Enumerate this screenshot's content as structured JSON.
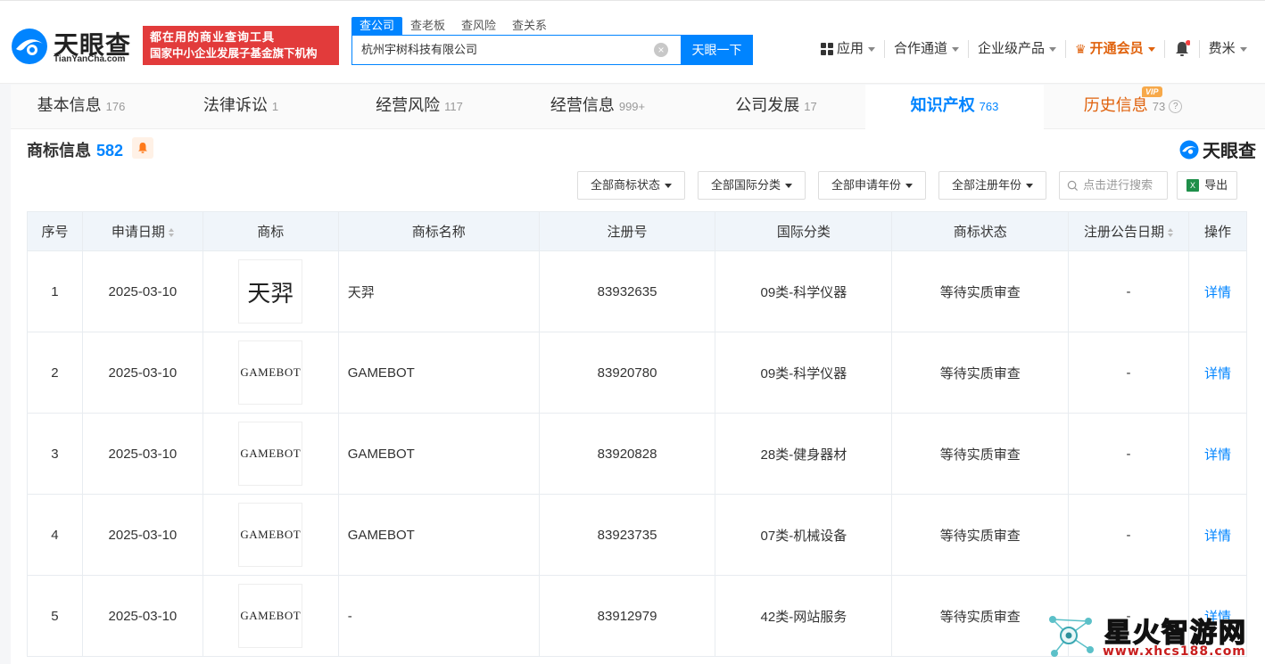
{
  "header": {
    "logo_text": "天眼查",
    "logo_sub": "TianYanCha.com",
    "slogan_line1": "都在用的商业查询工具",
    "slogan_line2": "国家中小企业发展子基金旗下机构",
    "search_tabs": [
      "查公司",
      "查老板",
      "查风险",
      "查关系"
    ],
    "search_value": "杭州宇树科技有限公司",
    "search_button": "天眼一下",
    "nav": {
      "apps": "应用",
      "channels": "合作通道",
      "enterprise": "企业级产品",
      "vip": "开通会员",
      "user": "费米"
    }
  },
  "tabs": [
    {
      "label": "基本信息",
      "count": "176"
    },
    {
      "label": "法律诉讼",
      "count": "1"
    },
    {
      "label": "经营风险",
      "count": "117"
    },
    {
      "label": "经营信息",
      "count": "999+"
    },
    {
      "label": "公司发展",
      "count": "17"
    },
    {
      "label": "知识产权",
      "count": "763"
    },
    {
      "label": "历史信息",
      "count": "73",
      "badge": "VIP"
    }
  ],
  "section": {
    "title": "商标信息",
    "count": "582",
    "brand": "天眼查"
  },
  "filters": {
    "status": "全部商标状态",
    "intl_class": "全部国际分类",
    "apply_year": "全部申请年份",
    "reg_year": "全部注册年份",
    "search_placeholder": "点击进行搜索",
    "export": "导出"
  },
  "table": {
    "headers": [
      "序号",
      "申请日期",
      "商标",
      "商标名称",
      "注册号",
      "国际分类",
      "商标状态",
      "注册公告日期",
      "操作"
    ],
    "rows": [
      {
        "idx": "1",
        "date": "2025-03-10",
        "mark": "天羿",
        "name": "天羿",
        "reg_no": "83932635",
        "class": "09类-科学仪器",
        "status": "等待实质审查",
        "pub_date": "-",
        "action": "详情"
      },
      {
        "idx": "2",
        "date": "2025-03-10",
        "mark": "GAMEBOT",
        "name": "GAMEBOT",
        "reg_no": "83920780",
        "class": "09类-科学仪器",
        "status": "等待实质审查",
        "pub_date": "-",
        "action": "详情"
      },
      {
        "idx": "3",
        "date": "2025-03-10",
        "mark": "GAMEBOT",
        "name": "GAMEBOT",
        "reg_no": "83920828",
        "class": "28类-健身器材",
        "status": "等待实质审查",
        "pub_date": "-",
        "action": "详情"
      },
      {
        "idx": "4",
        "date": "2025-03-10",
        "mark": "GAMEBOT",
        "name": "GAMEBOT",
        "reg_no": "83923735",
        "class": "07类-机械设备",
        "status": "等待实质审查",
        "pub_date": "-",
        "action": "详情"
      },
      {
        "idx": "5",
        "date": "2025-03-10",
        "mark": "GAMEBOT",
        "name": "-",
        "reg_no": "83912979",
        "class": "42类-网站服务",
        "status": "等待实质审查",
        "pub_date": "-",
        "action": "详情"
      }
    ]
  },
  "watermark": {
    "title": "星火智游网",
    "url": "www.xhcs188.com"
  }
}
